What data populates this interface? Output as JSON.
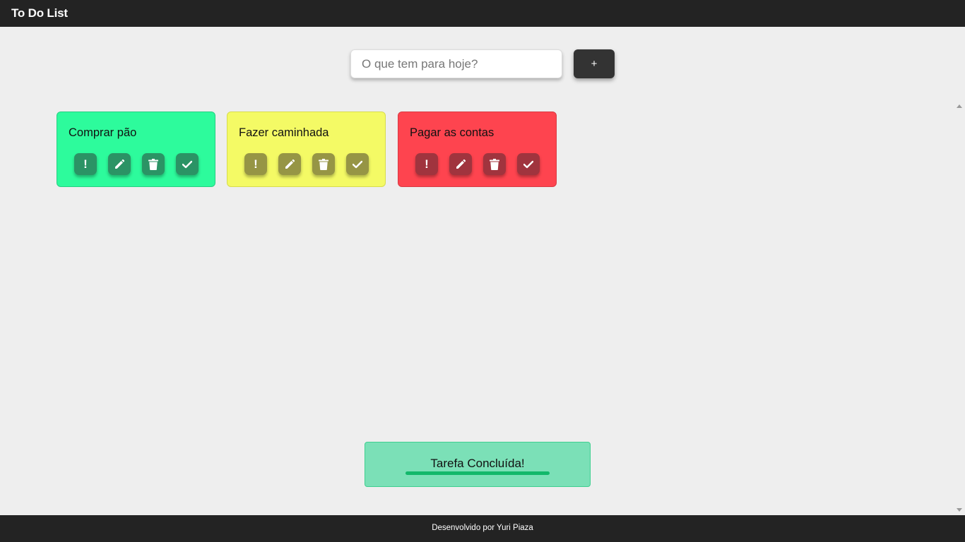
{
  "header": {
    "title": "To Do List"
  },
  "form": {
    "input_value": "",
    "input_placeholder": "O que tem para hoje?",
    "add_label": "+"
  },
  "tasks": [
    {
      "title": "Comprar pão",
      "color": "#2dfb9c",
      "priority": "green"
    },
    {
      "title": "Fazer caminhada",
      "color": "#f4fa65",
      "priority": "yellow"
    },
    {
      "title": "Pagar as contas",
      "color": "#fe444f",
      "priority": "red"
    }
  ],
  "task_actions": [
    {
      "icon": "exclamation-icon",
      "glyph": "!"
    },
    {
      "icon": "pencil-icon"
    },
    {
      "icon": "trash-icon"
    },
    {
      "icon": "check-icon"
    }
  ],
  "toast": {
    "message": "Tarefa Concluída!",
    "color": "#7be0b7"
  },
  "footer": {
    "credit": "Desenvolvido por Yuri Piaza"
  }
}
